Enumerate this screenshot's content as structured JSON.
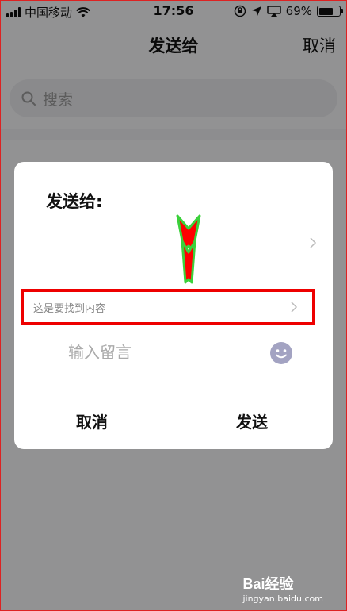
{
  "status_bar": {
    "carrier": "中国移动",
    "time": "17:56",
    "battery_percent": "69%",
    "battery_level": 0.69
  },
  "nav": {
    "title": "发送给",
    "cancel_label": "取消"
  },
  "search": {
    "placeholder": "搜索"
  },
  "dialog": {
    "title": "发送给:",
    "highlighted_item": "这是要找到内容",
    "message_placeholder": "输入留言",
    "cancel_label": "取消",
    "send_label": "发送"
  },
  "annotation": {
    "arrow_fill": "#ff0000",
    "arrow_stroke": "#3bd13b",
    "box_color": "#ee0000"
  },
  "watermark": {
    "logo": "Bai经验",
    "url": "jingyan.baidu.com"
  }
}
